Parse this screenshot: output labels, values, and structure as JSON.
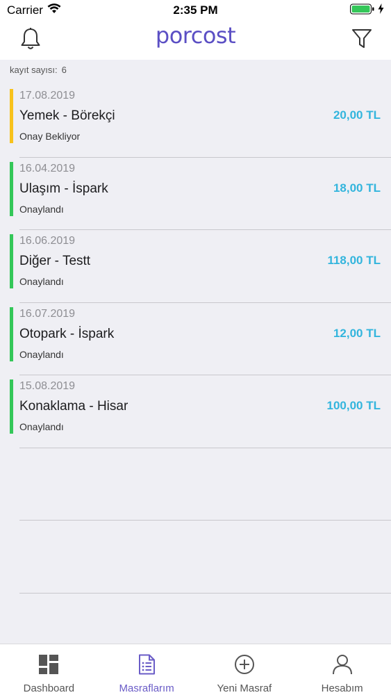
{
  "status_bar": {
    "carrier": "Carrier",
    "time": "2:35 PM"
  },
  "nav": {
    "logo": "porcost",
    "logo_color": "#5b4fc4"
  },
  "record_count": {
    "label": "kayıt sayısı:",
    "value": "6"
  },
  "expenses": [
    {
      "date": "17.08.2019",
      "title": "Yemek - Börekçi",
      "status": "Onay Bekliyor",
      "amount": "20,00 TL",
      "status_color": "#f8c21c"
    },
    {
      "date": "16.04.2019",
      "title": "Ulaşım - İspark",
      "status": "Onaylandı",
      "amount": "18,00 TL",
      "status_color": "#34c759"
    },
    {
      "date": "16.06.2019",
      "title": "Diğer - Testt",
      "status": "Onaylandı",
      "amount": "118,00 TL",
      "status_color": "#34c759"
    },
    {
      "date": "16.07.2019",
      "title": "Otopark - İspark",
      "status": "Onaylandı",
      "amount": "12,00 TL",
      "status_color": "#34c759"
    },
    {
      "date": "15.08.2019",
      "title": "Konaklama - Hisar",
      "status": "Onaylandı",
      "amount": "100,00 TL",
      "status_color": "#34c759"
    }
  ],
  "tabs": [
    {
      "label": "Dashboard",
      "icon": "dashboard-icon"
    },
    {
      "label": "Masraflarım",
      "icon": "expenses-list-icon",
      "active": true
    },
    {
      "label": "Yeni Masraf",
      "icon": "add-circle-icon"
    },
    {
      "label": "Hesabım",
      "icon": "account-icon"
    }
  ],
  "colors": {
    "accent": "#6a5cc7",
    "amount": "#33b5dd",
    "pending": "#f8c21c",
    "approved": "#34c759"
  }
}
